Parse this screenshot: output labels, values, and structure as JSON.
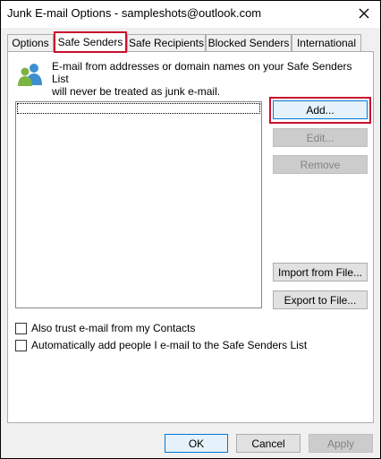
{
  "window": {
    "title": "Junk E-mail Options - sampleshots@outlook.com"
  },
  "tabs": [
    {
      "label": "Options",
      "active": false
    },
    {
      "label": "Safe Senders",
      "active": true
    },
    {
      "label": "Safe Recipients",
      "active": false
    },
    {
      "label": "Blocked Senders",
      "active": false
    },
    {
      "label": "International",
      "active": false
    }
  ],
  "panel": {
    "info_line1": "E-mail from addresses or domain names on your Safe Senders List",
    "info_line2": "will never be treated as junk e-mail.",
    "icon": "people-icon",
    "buttons": {
      "add": "Add...",
      "edit": "Edit...",
      "remove": "Remove",
      "import": "Import from File...",
      "export": "Export to File..."
    },
    "checkboxes": [
      {
        "label": "Also trust e-mail from my Contacts",
        "checked": false
      },
      {
        "label": "Automatically add people I e-mail to the Safe Senders List",
        "checked": false
      }
    ]
  },
  "footer": {
    "ok": "OK",
    "cancel": "Cancel",
    "apply": "Apply"
  },
  "colors": {
    "highlight": "#c8102e",
    "default_button_border": "#0078d7"
  }
}
